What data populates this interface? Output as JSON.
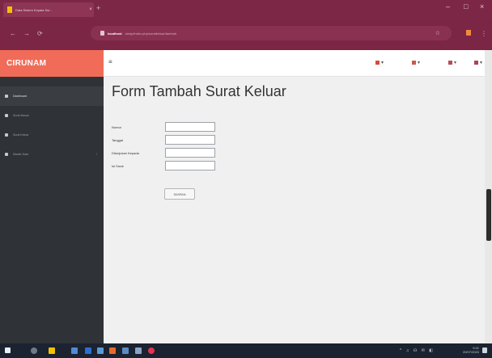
{
  "browser": {
    "tab_title": "Data Sistem Kepala Sur...",
    "tab_close": "×",
    "new_tab": "+",
    "window_controls": [
      "–",
      "□",
      "×"
    ],
    "nav": [
      "←",
      "→",
      "⟳"
    ],
    "url_host": "localhost",
    "url_path": "/arsip/index.php/suratkeluar/tambah",
    "star": "☆"
  },
  "app": {
    "brand": "CIRUNAM",
    "menu_toggle": "≡",
    "top_icons": [
      "▾",
      "▾",
      "▾",
      "▾"
    ],
    "colors": {
      "brand": "#f06c58",
      "sidebar": "#2f3236",
      "browser": "#7b2645"
    }
  },
  "sidebar": {
    "items": [
      {
        "label": "Dashboard",
        "icon": "dashboard-icon"
      },
      {
        "label": "Surat Masuk",
        "icon": "inbox-icon"
      },
      {
        "label": "Surat Keluar",
        "icon": "outbox-icon"
      },
      {
        "label": "Master Data",
        "icon": "database-icon",
        "chevron": "‹"
      }
    ]
  },
  "form": {
    "title": "Form Tambah Surat Keluar",
    "fields": [
      {
        "label": "Nomor",
        "value": ""
      },
      {
        "label": "Tanggal",
        "value": ""
      },
      {
        "label": "Ditunjukan Kepada",
        "value": ""
      },
      {
        "label": "Isi Surat",
        "value": ""
      }
    ],
    "save_label": "SIMPAN"
  },
  "taskbar": {
    "time": "9:41",
    "date": "20/07/2020",
    "tray": "^ ♫ ☊ ✉ ◧"
  }
}
